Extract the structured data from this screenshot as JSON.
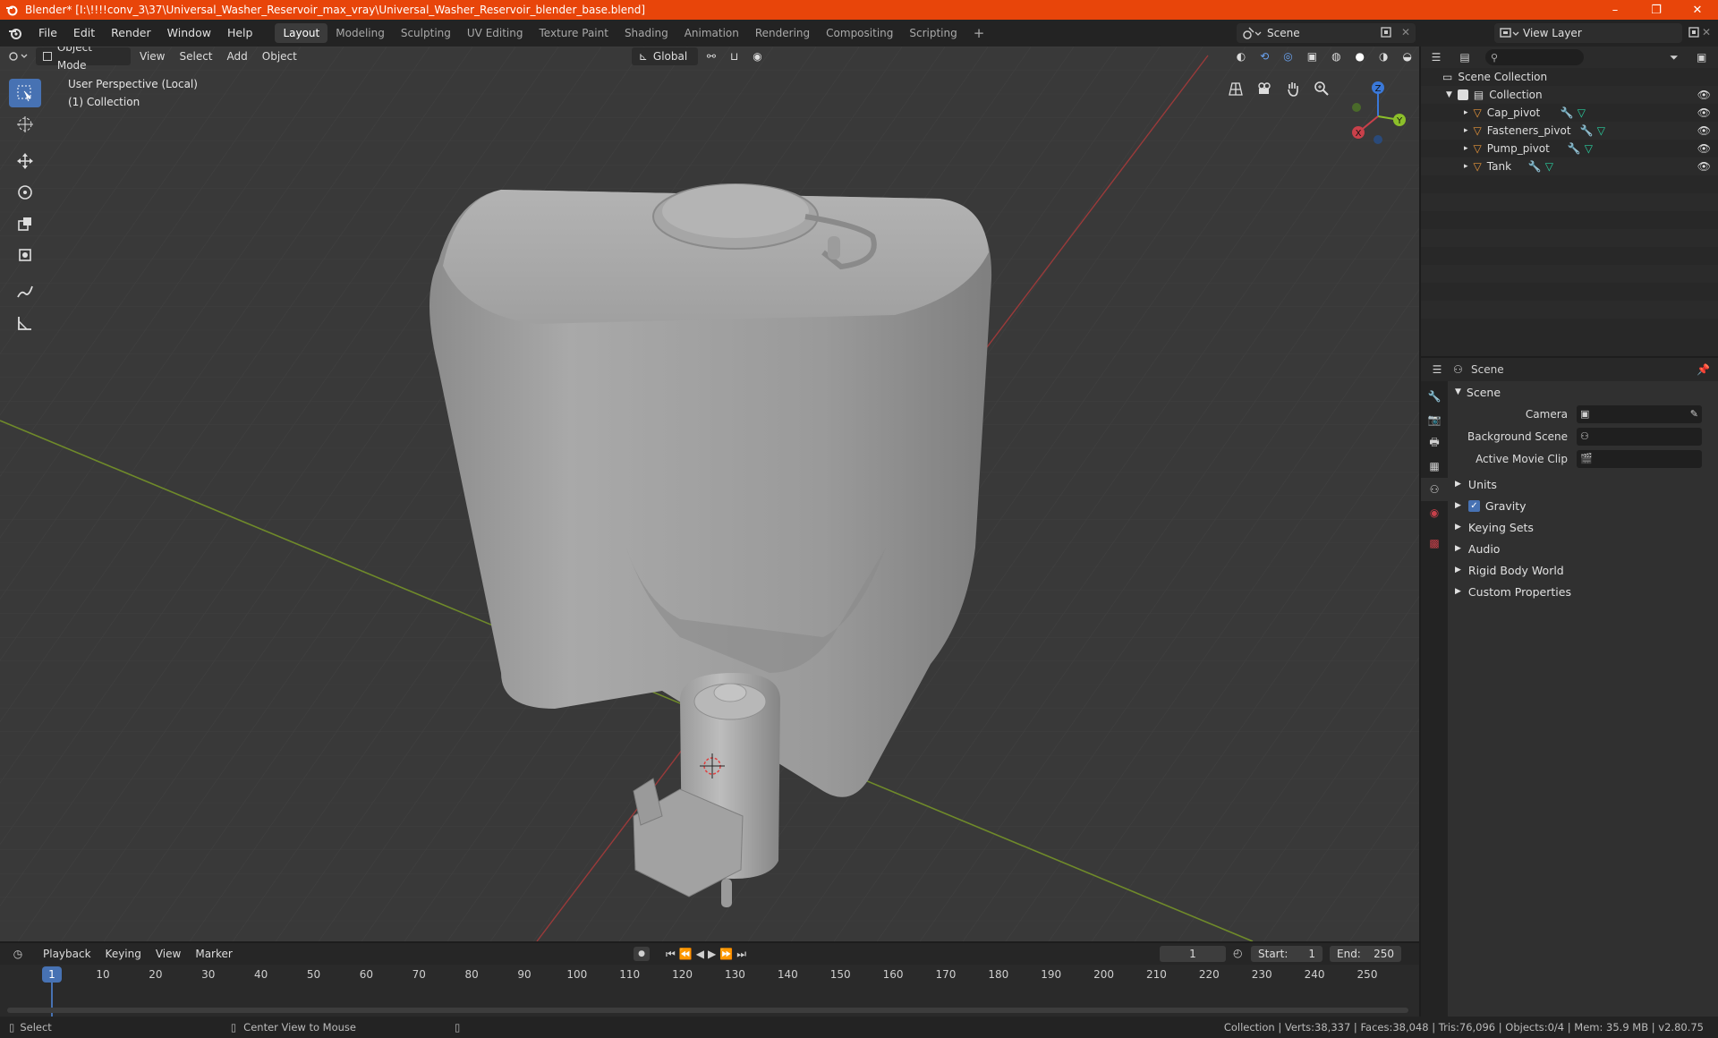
{
  "window": {
    "title": "Blender* [I:\\!!!!conv_3\\37\\Universal_Washer_Reservoir_max_vray\\Universal_Washer_Reservoir_blender_base.blend]",
    "minimize": "–",
    "maximize": "❐",
    "close": "✕"
  },
  "menu": {
    "file": "File",
    "edit": "Edit",
    "render": "Render",
    "window": "Window",
    "help": "Help"
  },
  "workspaces": [
    "Layout",
    "Modeling",
    "Sculpting",
    "UV Editing",
    "Texture Paint",
    "Shading",
    "Animation",
    "Rendering",
    "Compositing",
    "Scripting"
  ],
  "workspace_add": "+",
  "scene_selector": "Scene",
  "view_layer_selector": "View Layer",
  "viewport": {
    "mode": "Object Mode",
    "view": "View",
    "select": "Select",
    "add": "Add",
    "object": "Object",
    "transform_orientation": "Global",
    "info_line1": "User Perspective (Local)",
    "info_line2": "(1) Collection",
    "gizmo": {
      "x": "X",
      "y": "Y",
      "z": "Z"
    }
  },
  "outliner": {
    "root": "Scene Collection",
    "collection": "Collection",
    "items": [
      "Cap_pivot",
      "Fasteners_pivot",
      "Pump_pivot",
      "Tank"
    ]
  },
  "properties": {
    "header": "Scene",
    "panel": "Scene",
    "camera_label": "Camera",
    "background_scene_label": "Background Scene",
    "active_movie_clip_label": "Active Movie Clip",
    "subpanels": [
      "Units",
      "Gravity",
      "Keying Sets",
      "Audio",
      "Rigid Body World",
      "Custom Properties"
    ],
    "gravity_checked": true
  },
  "timeline": {
    "playback": "Playback",
    "keying": "Keying",
    "view": "View",
    "marker": "Marker",
    "current_frame": "1",
    "start_label": "Start:",
    "start": "1",
    "end_label": "End:",
    "end": "250",
    "ticks": [
      "1",
      "10",
      "20",
      "30",
      "40",
      "50",
      "60",
      "70",
      "80",
      "90",
      "100",
      "110",
      "120",
      "130",
      "140",
      "150",
      "160",
      "170",
      "180",
      "190",
      "200",
      "210",
      "220",
      "230",
      "240",
      "250"
    ]
  },
  "statusbar": {
    "select": "Select",
    "center_view": "Center View to Mouse",
    "stats": "Collection | Verts:38,337 | Faces:38,048 | Tris:76,096 | Objects:0/4 | Mem: 35.9 MB | v2.80.75"
  },
  "colors": {
    "titlebar": "#e8450a",
    "accent": "#4772b3",
    "x_axis": "#c8404a",
    "y_axis": "#8cbf2a",
    "z_axis": "#3a78d8",
    "object_icon": "#e8963a",
    "modifier_icon": "#6aa2f0",
    "mesh_icon": "#2ad0a0"
  }
}
